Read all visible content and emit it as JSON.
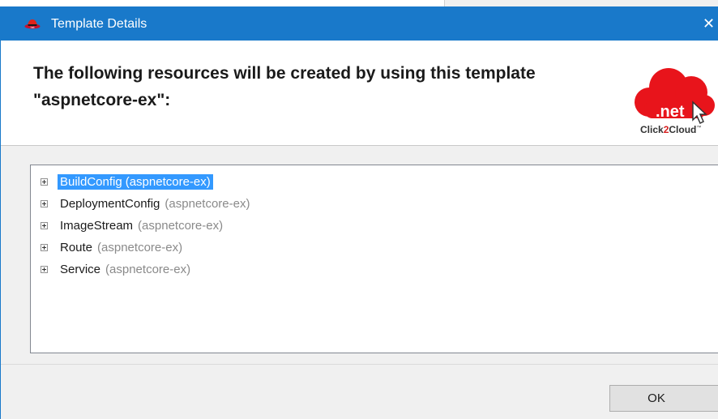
{
  "dialog": {
    "title": "Template Details",
    "close_glyph": "✕",
    "header_line1": "The following resources will be created by using this template",
    "header_line2": "\"aspnetcore-ex\":",
    "logo": {
      "icon": "dotnet-cloud-logo",
      "net_text": ".net",
      "caption_prefix": "Click",
      "caption_accent": "2",
      "caption_suffix": "Cloud",
      "trademark": "™"
    },
    "resources": [
      {
        "type": "BuildConfig",
        "name": "(aspnetcore-ex)",
        "selected": true
      },
      {
        "type": "DeploymentConfig",
        "name": "(aspnetcore-ex)",
        "selected": false
      },
      {
        "type": "ImageStream",
        "name": "(aspnetcore-ex)",
        "selected": false
      },
      {
        "type": "Route",
        "name": "(aspnetcore-ex)",
        "selected": false
      },
      {
        "type": "Service",
        "name": "(aspnetcore-ex)",
        "selected": false
      }
    ],
    "ok_label": "OK"
  },
  "colors": {
    "titlebar": "#1979ca",
    "selection": "#3399ff",
    "brand_red": "#e8141b"
  }
}
